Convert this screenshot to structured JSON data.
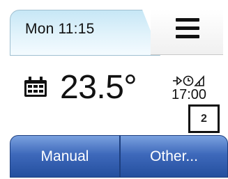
{
  "header": {
    "datetime": "Mon 11:15",
    "menu_icon": "hamburger-menu-icon"
  },
  "status": {
    "calendar_icon": "calendar-icon",
    "temperature": "23.5°",
    "schedule_icons": "arrow-clock-signal-icons",
    "next_event_time": "17:00"
  },
  "callout": {
    "label": "2"
  },
  "buttons": {
    "manual_label": "Manual",
    "other_label": "Other..."
  },
  "colors": {
    "header_tab": "#d9eff9",
    "button_blue": "#3e69bb",
    "text": "#111111"
  }
}
